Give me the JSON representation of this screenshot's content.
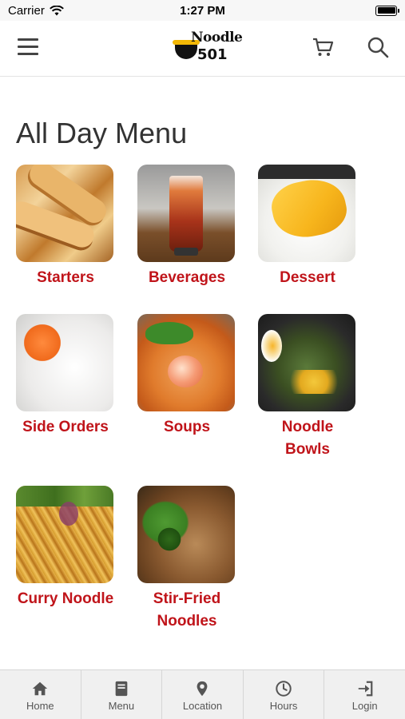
{
  "status_bar": {
    "carrier": "Carrier",
    "time": "1:27 PM"
  },
  "header": {
    "logo_text_top": "Noodle",
    "logo_text_bottom": "501",
    "menu_icon": "hamburger-icon",
    "cart_icon": "cart-icon",
    "search_icon": "search-icon"
  },
  "page": {
    "title": "All Day Menu"
  },
  "categories": [
    {
      "label": "Starters"
    },
    {
      "label": "Beverages"
    },
    {
      "label": "Dessert"
    },
    {
      "label": "Side Orders"
    },
    {
      "label": "Soups"
    },
    {
      "label": "Noodle Bowls"
    },
    {
      "label": "Curry Noodle"
    },
    {
      "label": "Stir-Fried Noodles"
    }
  ],
  "tabs": [
    {
      "label": "Home",
      "icon": "home-icon"
    },
    {
      "label": "Menu",
      "icon": "book-icon"
    },
    {
      "label": "Location",
      "icon": "location-pin-icon"
    },
    {
      "label": "Hours",
      "icon": "clock-icon"
    },
    {
      "label": "Login",
      "icon": "login-icon"
    }
  ],
  "colors": {
    "accent": "#c0141a",
    "title": "#333333",
    "tab_bg": "#f0f0f0"
  }
}
